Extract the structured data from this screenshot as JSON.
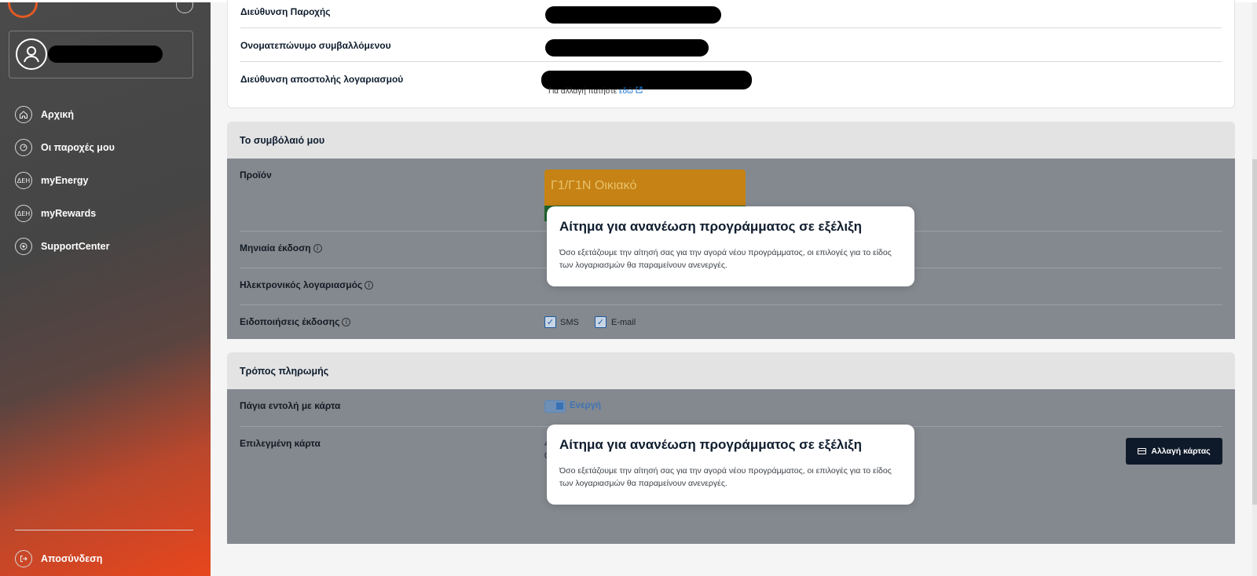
{
  "sidebar": {
    "nav": [
      {
        "label": "Αρχική",
        "icon": "home-icon"
      },
      {
        "label": "Οι παροχές μου",
        "icon": "meter-icon"
      },
      {
        "label": "myEnergy",
        "icon": "deh-icon"
      },
      {
        "label": "myRewards",
        "icon": "deh-icon"
      },
      {
        "label": "SupportCenter",
        "icon": "support-icon"
      }
    ],
    "logout_label": "Αποσύνδεση"
  },
  "details": {
    "supply_address_label": "Διεύθυνση Παροχής",
    "contractor_label": "Ονοματεπώνυμο συμβαλλόμενου",
    "billing_address_label": "Διεύθυνση αποστολής λογαριασμού",
    "change_note_prefix": "Για αλλαγή πατήστε",
    "change_note_link": "εδώ"
  },
  "contract": {
    "title": "Το συμβόλαιό μου",
    "product_label": "Προϊόν",
    "product_name": "Γ1/Γ1Ν Οικιακό",
    "monthly_label": "Μηνιαία έκδοση",
    "ebill_label": "Ηλεκτρονικός λογαριασμός",
    "notifications_label": "Ειδοποιήσεις έκδοσης",
    "sms_label": "SMS",
    "email_label": "E-mail",
    "info_glyph": "i",
    "check_glyph": "✓"
  },
  "payment": {
    "title": "Τρόπος πληρωμής",
    "standing_order_label": "Πάγια εντολή με κάρτα",
    "standing_order_status": "Ενεργή",
    "selected_card_label": "Επιλεγμένη κάρτα",
    "card_line1": "4",
    "card_line2": "0",
    "change_card_button": "Αλλαγή κάρτας"
  },
  "popups": [
    {
      "title": "Αίτημα για ανανέωση προγράμματος σε εξέλιξη",
      "text": "Όσο εξετάζουμε την αίτησή σας για την αγορά νέου προγράμματος, οι επιλογές για το είδος των λογαριασμών θα παραμείνουν ανενεργές."
    },
    {
      "title": "Αίτημα για ανανέωση προγράμματος σε εξέλιξη",
      "text": "Όσο εξετάζουμε την αίτησή σας για την αγορά νέου προγράμματος, οι επιλογές για το είδος των λογαριασμών θα παραμείνουν ανενεργές."
    }
  ]
}
